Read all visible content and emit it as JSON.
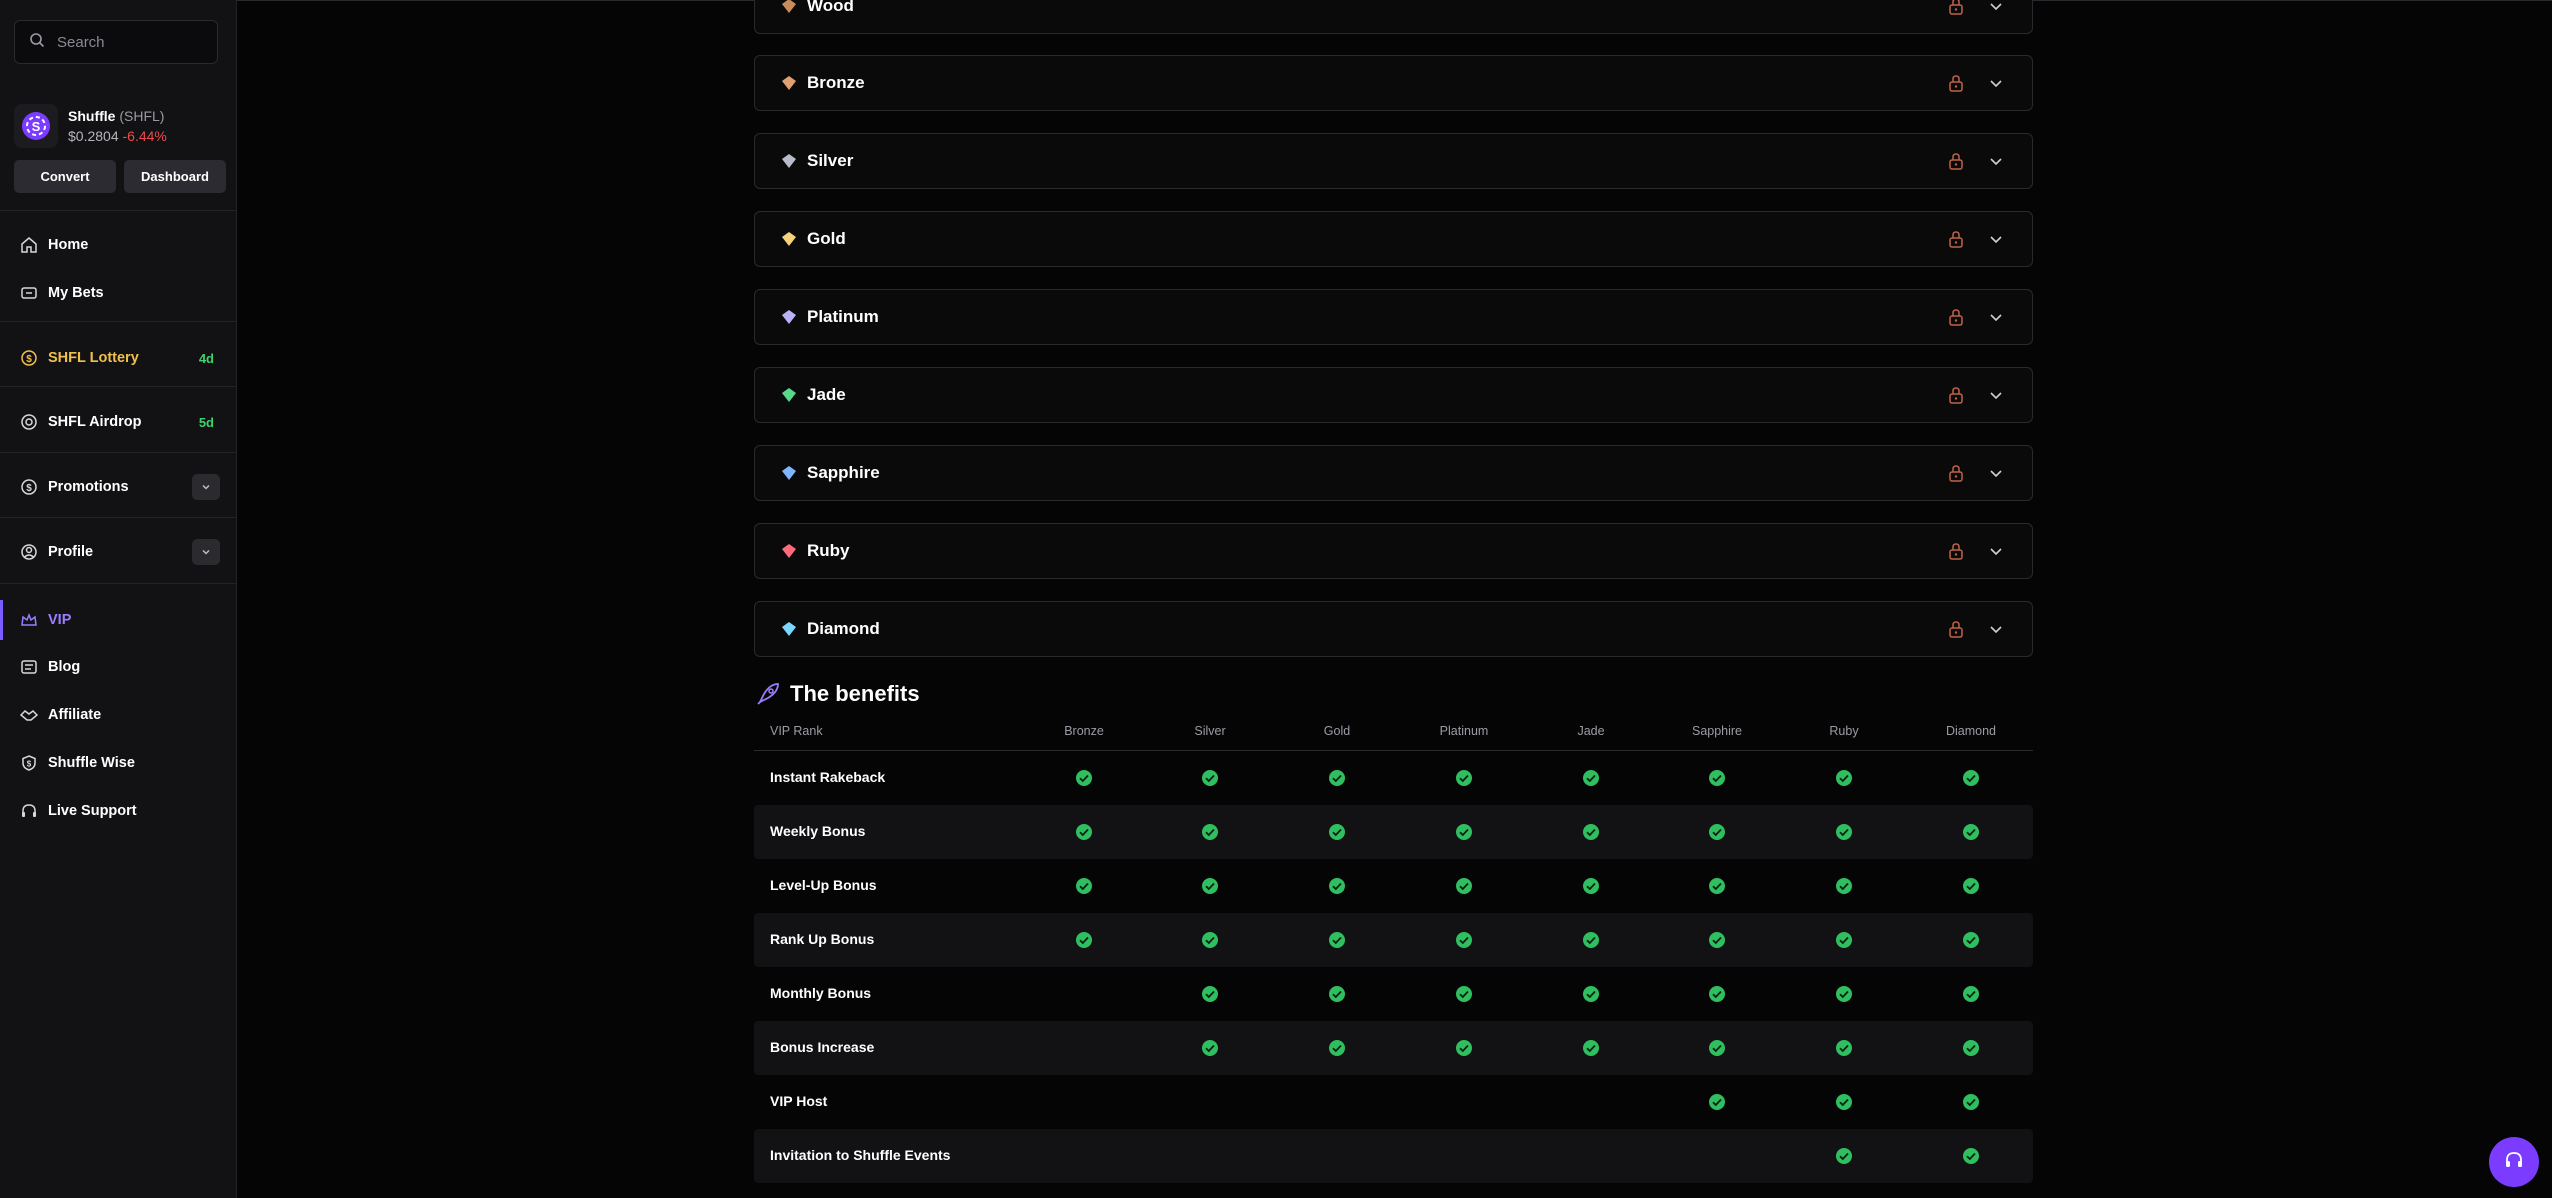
{
  "search": {
    "placeholder": "Search"
  },
  "token": {
    "name": "Shuffle",
    "symbol": "(SHFL)",
    "price": "$0.2804",
    "change": "-6.44%",
    "convert_label": "Convert",
    "dashboard_label": "Dashboard"
  },
  "nav": {
    "home": "Home",
    "my_bets": "My Bets",
    "lottery": "SHFL Lottery",
    "lottery_badge": "4d",
    "airdrop": "SHFL Airdrop",
    "airdrop_badge": "5d",
    "promotions": "Promotions",
    "profile": "Profile",
    "vip": "VIP",
    "blog": "Blog",
    "affiliate": "Affiliate",
    "shuffle_wise": "Shuffle Wise",
    "live_support": "Live Support"
  },
  "ranks": [
    {
      "label": "Wood",
      "color": "#c98b5a"
    },
    {
      "label": "Bronze",
      "color": "#e0a070"
    },
    {
      "label": "Silver",
      "color": "#b8bcc8"
    },
    {
      "label": "Gold",
      "color": "#f6d27a"
    },
    {
      "label": "Platinum",
      "color": "#b9b2f5"
    },
    {
      "label": "Jade",
      "color": "#57d98a"
    },
    {
      "label": "Sapphire",
      "color": "#7fb6ff"
    },
    {
      "label": "Ruby",
      "color": "#ff6b7a"
    },
    {
      "label": "Diamond",
      "color": "#7ad8ff"
    }
  ],
  "benefits": {
    "title": "The benefits",
    "columns": [
      "VIP Rank",
      "Bronze",
      "Silver",
      "Gold",
      "Platinum",
      "Jade",
      "Sapphire",
      "Ruby",
      "Diamond"
    ],
    "rows": [
      {
        "name": "Instant Rakeback",
        "checks": [
          true,
          true,
          true,
          true,
          true,
          true,
          true,
          true
        ]
      },
      {
        "name": "Weekly Bonus",
        "checks": [
          true,
          true,
          true,
          true,
          true,
          true,
          true,
          true
        ]
      },
      {
        "name": "Level-Up Bonus",
        "checks": [
          true,
          true,
          true,
          true,
          true,
          true,
          true,
          true
        ]
      },
      {
        "name": "Rank Up Bonus",
        "checks": [
          true,
          true,
          true,
          true,
          true,
          true,
          true,
          true
        ]
      },
      {
        "name": "Monthly Bonus",
        "checks": [
          false,
          true,
          true,
          true,
          true,
          true,
          true,
          true
        ]
      },
      {
        "name": "Bonus Increase",
        "checks": [
          false,
          true,
          true,
          true,
          true,
          true,
          true,
          true
        ]
      },
      {
        "name": "VIP Host",
        "checks": [
          false,
          false,
          false,
          false,
          false,
          true,
          true,
          true
        ]
      },
      {
        "name": "Invitation to Shuffle Events",
        "checks": [
          false,
          false,
          false,
          false,
          false,
          false,
          true,
          true
        ]
      }
    ]
  },
  "colors": {
    "accent": "#7b5cff",
    "lottery": "#f2c04a",
    "badge": "#3fd36e",
    "check": "#2fbf60",
    "lock": "#c0624a",
    "negative": "#f04a4a"
  }
}
